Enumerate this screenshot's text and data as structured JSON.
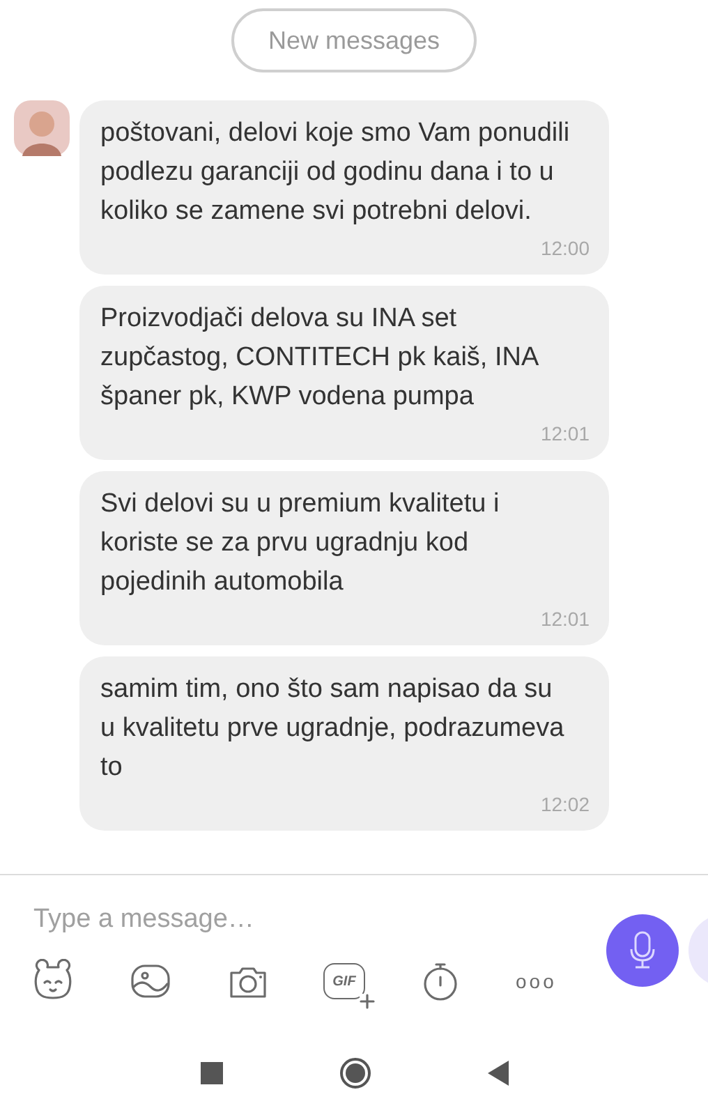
{
  "new_messages_button": "New messages",
  "messages": [
    {
      "text": "poštovani, delovi koje smo Vam ponudili podlezu garanciji od godinu dana i to u koliko se zamene svi potrebni delovi.",
      "time": "12:00",
      "show_avatar": true
    },
    {
      "text": "Proizvodjači delova su INA set zupčastog, CONTITECH pk kaiš, INA španer pk, KWP vodena pumpa",
      "time": "12:01",
      "show_avatar": false
    },
    {
      "text": "Svi delovi su u premium kvalitetu i koriste se za prvu ugradnju kod pojedinih automobila",
      "time": "12:01",
      "show_avatar": false
    },
    {
      "text": "samim tim, ono što sam napisao da su u kvalitetu prve ugradnje, podrazumeva to",
      "time": "12:02",
      "show_avatar": false
    }
  ],
  "composer": {
    "placeholder": "Type a message…",
    "gif_label": "GIF",
    "more_label": "ooo"
  }
}
